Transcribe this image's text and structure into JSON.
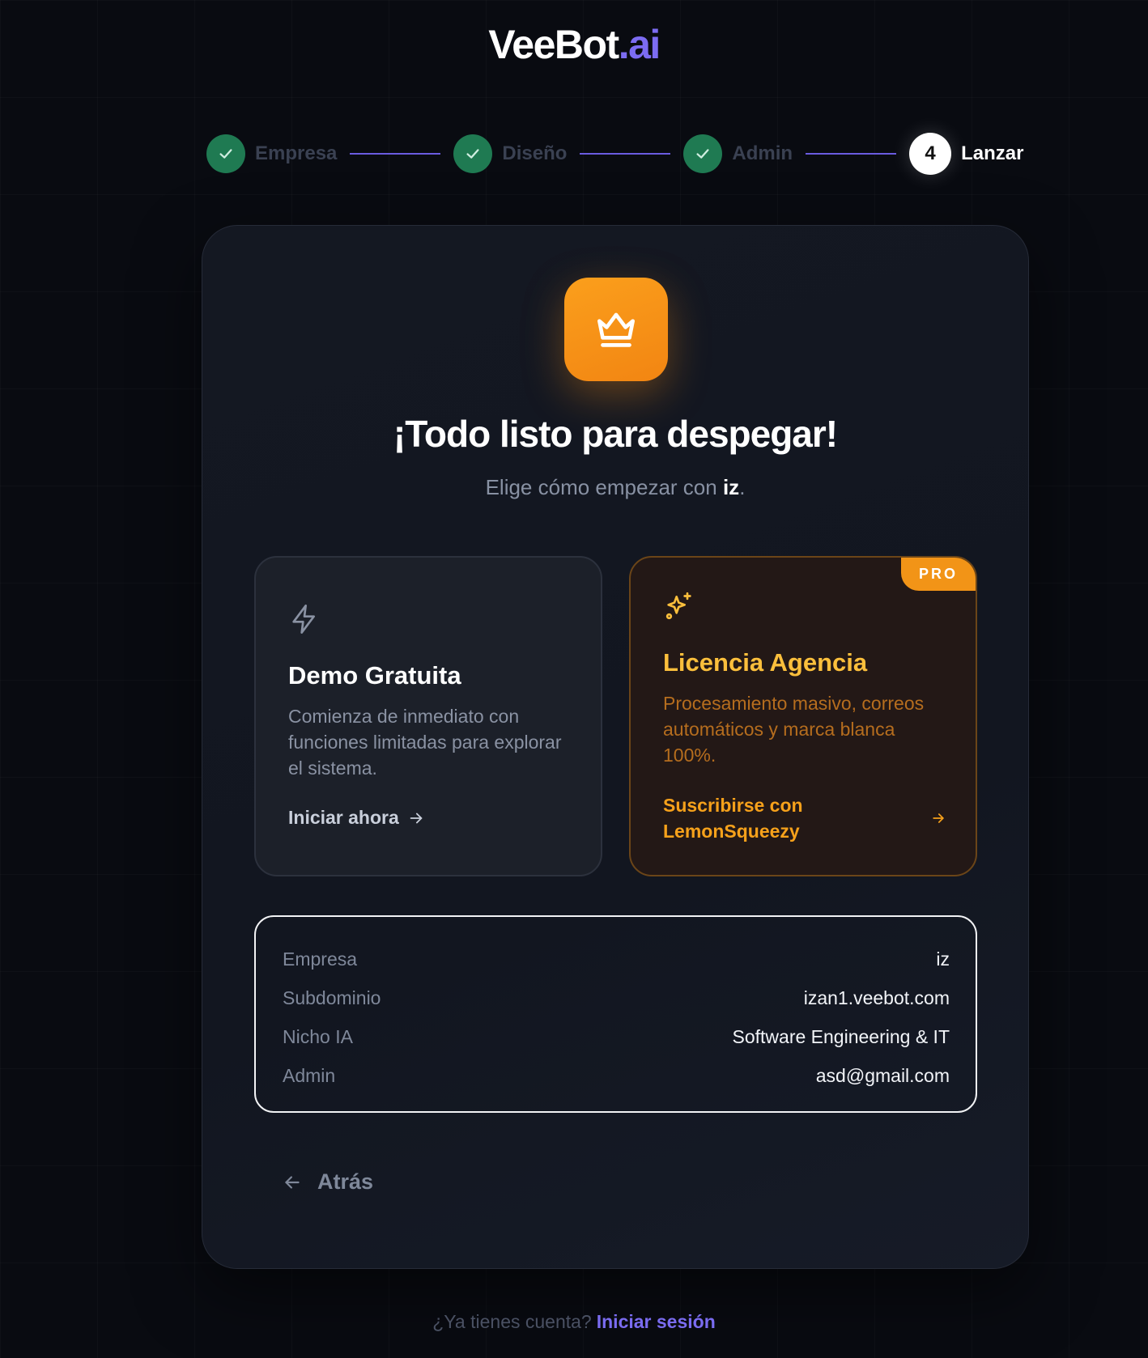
{
  "brand": {
    "name": "VeeBot",
    "tld": ".ai",
    "accent_color": "#7c6cf2"
  },
  "stepper": {
    "steps": [
      {
        "label": "Empresa",
        "state": "done"
      },
      {
        "label": "Diseño",
        "state": "done"
      },
      {
        "label": "Admin",
        "state": "done"
      },
      {
        "label": "Lanzar",
        "state": "active",
        "number": "4"
      }
    ]
  },
  "main": {
    "icon": "crown-icon",
    "title": "¡Todo listo para despegar!",
    "subtitle_prefix": "Elige cómo empezar con ",
    "subtitle_name": "iz",
    "subtitle_suffix": "."
  },
  "options": {
    "demo": {
      "icon": "lightning-icon",
      "title": "Demo Gratuita",
      "description": "Comienza de inmediato con funciones limitadas para explorar el sistema.",
      "cta": "Iniciar ahora"
    },
    "pro": {
      "badge": "PRO",
      "icon": "sparkles-icon",
      "title": "Licencia Agencia",
      "description": "Procesamiento masivo, correos automáticos y marca blanca 100%.",
      "cta": "Suscribirse con LemonSqueezy"
    }
  },
  "summary": {
    "rows": [
      {
        "key": "Empresa",
        "value": "iz"
      },
      {
        "key": "Subdominio",
        "value": "izan1.veebot.com"
      },
      {
        "key": "Nicho IA",
        "value": "Software Engineering & IT"
      },
      {
        "key": "Admin",
        "value": "asd@gmail.com"
      }
    ]
  },
  "back_label": "Atrás",
  "footer": {
    "question": "¿Ya tienes cuenta?",
    "link": "Iniciar sesión"
  }
}
